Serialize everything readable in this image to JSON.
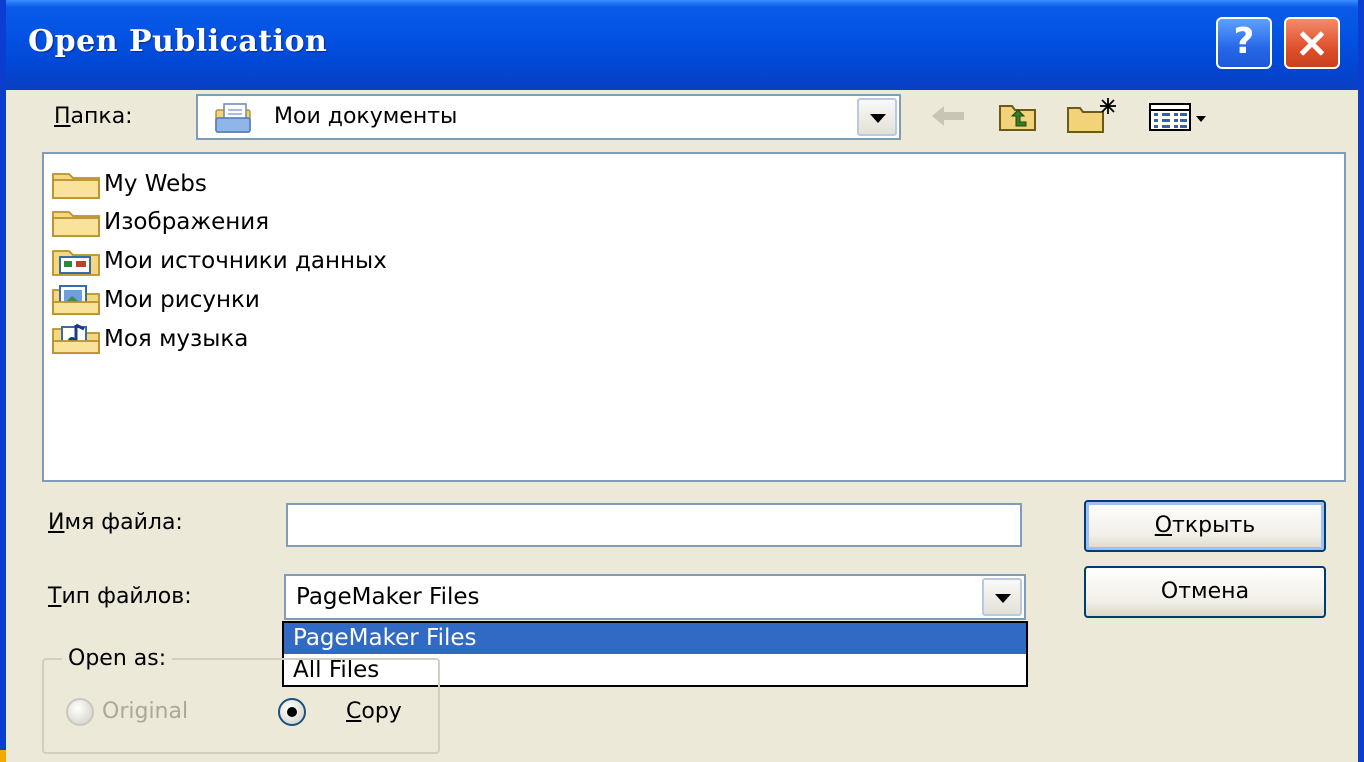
{
  "window": {
    "title": "Open Publication",
    "help_label": "?"
  },
  "folder": {
    "label_first": "П",
    "label_rest": "апка:",
    "current": "Мои документы"
  },
  "toolbar": {
    "icons": [
      "back-arrow-icon",
      "up-one-level-icon",
      "new-folder-icon",
      "view-menu-icon"
    ]
  },
  "files": [
    {
      "name": "My Webs",
      "icon": "folder-icon"
    },
    {
      "name": "Изображения",
      "icon": "folder-icon"
    },
    {
      "name": "Мои источники данных",
      "icon": "data-sources-folder-icon"
    },
    {
      "name": "Мои рисунки",
      "icon": "pictures-folder-icon"
    },
    {
      "name": "Моя музыка",
      "icon": "music-folder-icon"
    }
  ],
  "filename": {
    "label_first": "И",
    "label_rest": "мя файла:",
    "value": "",
    "placeholder": ""
  },
  "filetype": {
    "label_first": "Т",
    "label_rest": "ип файлов:",
    "selected": "PageMaker Files",
    "options": [
      "PageMaker Files",
      "All Files"
    ]
  },
  "buttons": {
    "open_first": "О",
    "open_rest": "ткрыть",
    "cancel": "Отмена"
  },
  "open_as": {
    "legend": "Open as:",
    "original": "Original",
    "copy_first": "C",
    "copy_rest": "opy"
  },
  "colors": {
    "title_blue": "#0352e3",
    "selection": "#316ac5",
    "dialog_bg": "#ece9d8"
  }
}
